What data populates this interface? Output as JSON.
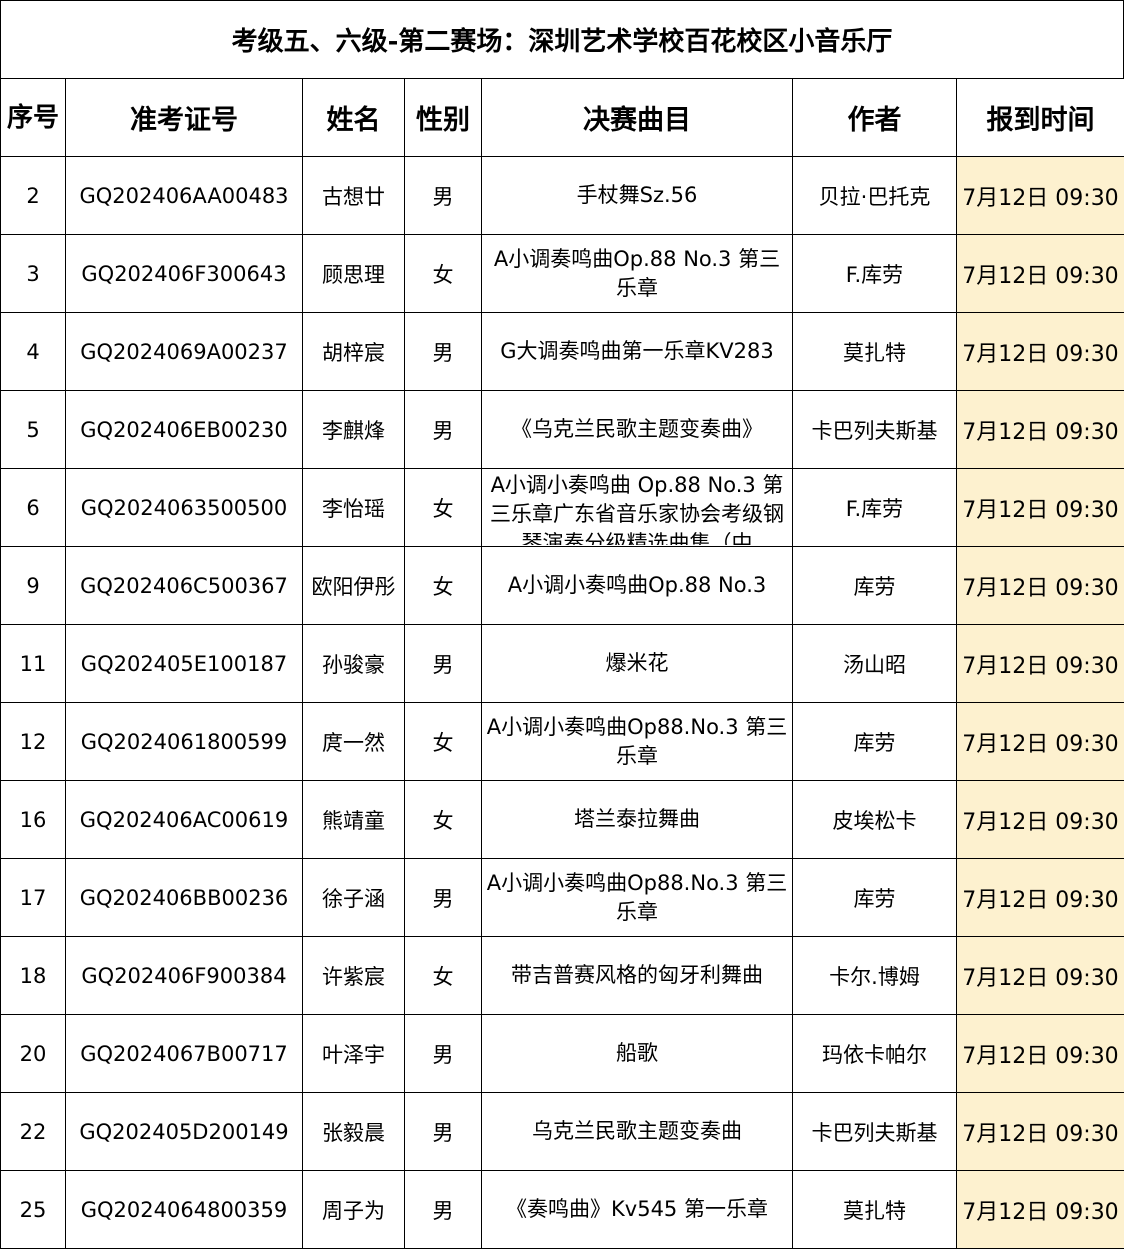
{
  "title": "考级五、六级-第二赛场：深圳艺术学校百花校区小音乐厅",
  "headers": {
    "seq": "序号",
    "exam_id": "准考证号",
    "name": "姓名",
    "gender": "性别",
    "piece": "决赛曲目",
    "composer": "作者",
    "checkin": "报到时间"
  },
  "rows": [
    {
      "seq": "2",
      "exam_id": "GQ202406AA00483",
      "name": "古想廿",
      "gender": "男",
      "piece": "手杖舞Sz.56",
      "composer": "贝拉·巴托克",
      "checkin": "7月12日 09:30"
    },
    {
      "seq": "3",
      "exam_id": "GQ202406F300643",
      "name": "顾思理",
      "gender": "女",
      "piece": "A小调奏鸣曲Op.88 No.3  第三乐章",
      "composer": "F.库劳",
      "checkin": "7月12日 09:30"
    },
    {
      "seq": "4",
      "exam_id": "GQ2024069A00237",
      "name": "胡梓宸",
      "gender": "男",
      "piece": "G大调奏鸣曲第一乐章KV283",
      "composer": "莫扎特",
      "checkin": "7月12日 09:30"
    },
    {
      "seq": "5",
      "exam_id": "GQ202406EB00230",
      "name": "李麒烽",
      "gender": "男",
      "piece": "《乌克兰民歌主题变奏曲》",
      "composer": "卡巴列夫斯基",
      "checkin": "7月12日 09:30"
    },
    {
      "seq": "6",
      "exam_id": "GQ2024063500500",
      "name": "李怡瑶",
      "gender": "女",
      "piece": "A小调小奏鸣曲  Op.88 No.3 第三乐章广东省音乐家协会考级钢琴演奏分级精选曲集（中",
      "composer": "F.库劳",
      "checkin": "7月12日 09:30"
    },
    {
      "seq": "9",
      "exam_id": "GQ202406C500367",
      "name": "欧阳伊彤",
      "gender": "女",
      "piece": "A小调小奏鸣曲Op.88 No.3",
      "composer": "库劳",
      "checkin": "7月12日 09:30"
    },
    {
      "seq": "11",
      "exam_id": "GQ202405E100187",
      "name": "孙骏豪",
      "gender": "男",
      "piece": "爆米花",
      "composer": "汤山昭",
      "checkin": "7月12日 09:30"
    },
    {
      "seq": "12",
      "exam_id": "GQ2024061800599",
      "name": "庹一然",
      "gender": "女",
      "piece": "A小调小奏鸣曲Op88.No.3 第三乐章",
      "composer": "库劳",
      "checkin": "7月12日 09:30"
    },
    {
      "seq": "16",
      "exam_id": "GQ202406AC00619",
      "name": "熊靖童",
      "gender": "女",
      "piece": "塔兰泰拉舞曲",
      "composer": "皮埃松卡",
      "checkin": "7月12日 09:30"
    },
    {
      "seq": "17",
      "exam_id": "GQ202406BB00236",
      "name": "徐子涵",
      "gender": "男",
      "piece": "A小调小奏鸣曲Op88.No.3 第三乐章",
      "composer": "库劳",
      "checkin": "7月12日 09:30"
    },
    {
      "seq": "18",
      "exam_id": "GQ202406F900384",
      "name": "许紫宸",
      "gender": "女",
      "piece": "带吉普赛风格的匈牙利舞曲",
      "composer": "卡尔.博姆",
      "checkin": "7月12日 09:30"
    },
    {
      "seq": "20",
      "exam_id": "GQ2024067B00717",
      "name": "叶泽宇",
      "gender": "男",
      "piece": "船歌",
      "composer": "玛依卡帕尔",
      "checkin": "7月12日 09:30"
    },
    {
      "seq": "22",
      "exam_id": "GQ202405D200149",
      "name": "张毅晨",
      "gender": "男",
      "piece": "乌克兰民歌主题变奏曲",
      "composer": "卡巴列夫斯基",
      "checkin": "7月12日 09:30"
    },
    {
      "seq": "25",
      "exam_id": "GQ2024064800359",
      "name": "周子为",
      "gender": "男",
      "piece": "《奏鸣曲》Kv545   第一乐章",
      "composer": "莫扎特",
      "checkin": "7月12日 09:30"
    }
  ],
  "colors": {
    "checkin_bg": "#fdf1cf",
    "border": "#000000"
  }
}
